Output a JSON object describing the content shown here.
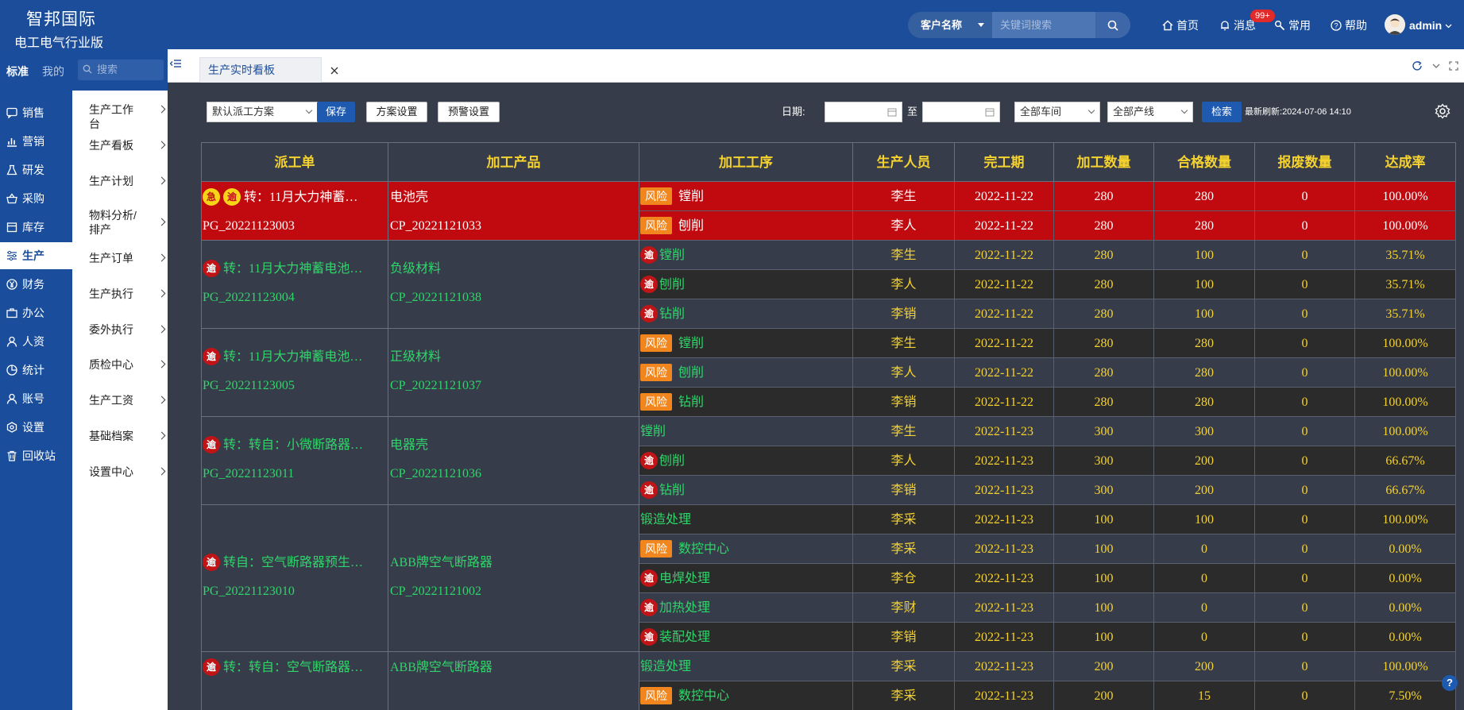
{
  "app": {
    "brand_line1": "智邦国际",
    "brand_line2": "电工电气行业版"
  },
  "topbar": {
    "customer_select": "客户名称",
    "search_placeholder": "关键词搜索",
    "nav": {
      "home": "首页",
      "messages": "消息",
      "messages_badge": "99+",
      "common": "常用",
      "help": "帮助",
      "user": "admin"
    }
  },
  "sidebar": {
    "tabs": {
      "standard": "标准",
      "mine": "我的"
    },
    "search_placeholder": "搜索",
    "items": [
      {
        "label": "销售",
        "icon": "chat-icon"
      },
      {
        "label": "营销",
        "icon": "chart-icon"
      },
      {
        "label": "研发",
        "icon": "flask-icon"
      },
      {
        "label": "采购",
        "icon": "basket-icon"
      },
      {
        "label": "库存",
        "icon": "box-icon"
      },
      {
        "label": "生产",
        "icon": "sliders-icon"
      },
      {
        "label": "财务",
        "icon": "yen-icon"
      },
      {
        "label": "办公",
        "icon": "briefcase-icon"
      },
      {
        "label": "人资",
        "icon": "person-icon"
      },
      {
        "label": "统计",
        "icon": "pie-icon"
      },
      {
        "label": "账号",
        "icon": "user-icon"
      },
      {
        "label": "设置",
        "icon": "gear-icon"
      },
      {
        "label": "回收站",
        "icon": "trash-icon"
      }
    ],
    "active_index": 5
  },
  "submenu": [
    "生产工作台",
    "生产看板",
    "生产计划",
    "物料分析/排产",
    "生产订单",
    "生产执行",
    "委外执行",
    "质检中心",
    "生产工资",
    "基础档案",
    "设置中心"
  ],
  "tabs": {
    "active": "生产实时看板"
  },
  "toolbar": {
    "scheme": "默认派工方案",
    "save": "保存",
    "scheme_settings": "方案设置",
    "warning_settings": "预警设置",
    "date_label": "日期:",
    "date_to": "至",
    "workshop": "全部车间",
    "line": "全部产线",
    "search": "检索",
    "refresh_label": "最新刷新:",
    "refresh_time": "2024-07-06 14:10"
  },
  "colors": {
    "urgent_row": "#c00a0f",
    "text_green": "#2fd56a",
    "text_yellow": "#f5d22e",
    "risk_tag": "#f0861d",
    "overdue_tag": "#c11416"
  },
  "table": {
    "headers": [
      "派工单",
      "加工产品",
      "加工工序",
      "生产人员",
      "完工期",
      "加工数量",
      "合格数量",
      "报废数量",
      "达成率"
    ],
    "groups": [
      {
        "tags": [
          "急",
          "逾"
        ],
        "title": "转：11月大力神蓄…",
        "order_no": "PG_20221123003",
        "product": "电池壳",
        "product_code": "CP_20221121033",
        "urgent": true,
        "rows": [
          {
            "flag": "风险",
            "process": "镗削",
            "worker": "李生",
            "date": "2022-11-22",
            "qty": "280",
            "ok": "280",
            "scrap": "0",
            "rate": "100.00%"
          },
          {
            "flag": "风险",
            "process": "刨削",
            "worker": "李人",
            "date": "2022-11-22",
            "qty": "280",
            "ok": "280",
            "scrap": "0",
            "rate": "100.00%"
          }
        ]
      },
      {
        "tags": [
          "逾"
        ],
        "title": "转：11月大力神蓄电池…",
        "order_no": "PG_20221123004",
        "product": "负级材料",
        "product_code": "CP_20221121038",
        "urgent": false,
        "rows": [
          {
            "flag": "逾",
            "process": "镗削",
            "worker": "李生",
            "date": "2022-11-22",
            "qty": "280",
            "ok": "100",
            "scrap": "0",
            "rate": "35.71%"
          },
          {
            "flag": "逾",
            "process": "刨削",
            "worker": "李人",
            "date": "2022-11-22",
            "qty": "280",
            "ok": "100",
            "scrap": "0",
            "rate": "35.71%"
          },
          {
            "flag": "逾",
            "process": "钻削",
            "worker": "李销",
            "date": "2022-11-22",
            "qty": "280",
            "ok": "100",
            "scrap": "0",
            "rate": "35.71%"
          }
        ]
      },
      {
        "tags": [
          "逾"
        ],
        "title": "转：11月大力神蓄电池…",
        "order_no": "PG_20221123005",
        "product": "正级材料",
        "product_code": "CP_20221121037",
        "urgent": false,
        "rows": [
          {
            "flag": "风险",
            "process": "镗削",
            "worker": "李生",
            "date": "2022-11-22",
            "qty": "280",
            "ok": "280",
            "scrap": "0",
            "rate": "100.00%"
          },
          {
            "flag": "风险",
            "process": "刨削",
            "worker": "李人",
            "date": "2022-11-22",
            "qty": "280",
            "ok": "280",
            "scrap": "0",
            "rate": "100.00%"
          },
          {
            "flag": "风险",
            "process": "钻削",
            "worker": "李销",
            "date": "2022-11-22",
            "qty": "280",
            "ok": "280",
            "scrap": "0",
            "rate": "100.00%"
          }
        ]
      },
      {
        "tags": [
          "逾"
        ],
        "title": "转：转自：小微断路器…",
        "order_no": "PG_20221123011",
        "product": "电器壳",
        "product_code": "CP_20221121036",
        "urgent": false,
        "rows": [
          {
            "flag": "",
            "process": "镗削",
            "worker": "李生",
            "date": "2022-11-23",
            "qty": "300",
            "ok": "300",
            "scrap": "0",
            "rate": "100.00%"
          },
          {
            "flag": "逾",
            "process": "刨削",
            "worker": "李人",
            "date": "2022-11-23",
            "qty": "300",
            "ok": "200",
            "scrap": "0",
            "rate": "66.67%"
          },
          {
            "flag": "逾",
            "process": "钻削",
            "worker": "李销",
            "date": "2022-11-23",
            "qty": "300",
            "ok": "200",
            "scrap": "0",
            "rate": "66.67%"
          }
        ]
      },
      {
        "tags": [
          "逾"
        ],
        "title": "转自：空气断路器预生…",
        "order_no": "PG_20221123010",
        "product": "ABB牌空气断路器",
        "product_code": "CP_20221121002",
        "urgent": false,
        "rows": [
          {
            "flag": "",
            "process": "锻造处理",
            "worker": "李采",
            "date": "2022-11-23",
            "qty": "100",
            "ok": "100",
            "scrap": "0",
            "rate": "100.00%"
          },
          {
            "flag": "风险",
            "process": "数控中心",
            "worker": "李采",
            "date": "2022-11-23",
            "qty": "100",
            "ok": "0",
            "scrap": "0",
            "rate": "0.00%"
          },
          {
            "flag": "逾",
            "process": "电焊处理",
            "worker": "李仓",
            "date": "2022-11-23",
            "qty": "100",
            "ok": "0",
            "scrap": "0",
            "rate": "0.00%"
          },
          {
            "flag": "逾",
            "process": "加热处理",
            "worker": "李财",
            "date": "2022-11-23",
            "qty": "100",
            "ok": "0",
            "scrap": "0",
            "rate": "0.00%"
          },
          {
            "flag": "逾",
            "process": "装配处理",
            "worker": "李销",
            "date": "2022-11-23",
            "qty": "100",
            "ok": "0",
            "scrap": "0",
            "rate": "0.00%"
          }
        ]
      },
      {
        "tags": [
          "逾"
        ],
        "title": "转：转自：空气断路器…",
        "order_no": "",
        "product": "ABB牌空气断路器",
        "product_code": "",
        "urgent": false,
        "rows": [
          {
            "flag": "",
            "process": "锻造处理",
            "worker": "李采",
            "date": "2022-11-23",
            "qty": "200",
            "ok": "200",
            "scrap": "0",
            "rate": "100.00%"
          },
          {
            "flag": "风险",
            "process": "数控中心",
            "worker": "李采",
            "date": "2022-11-23",
            "qty": "200",
            "ok": "15",
            "scrap": "0",
            "rate": "7.50%"
          }
        ]
      }
    ]
  }
}
